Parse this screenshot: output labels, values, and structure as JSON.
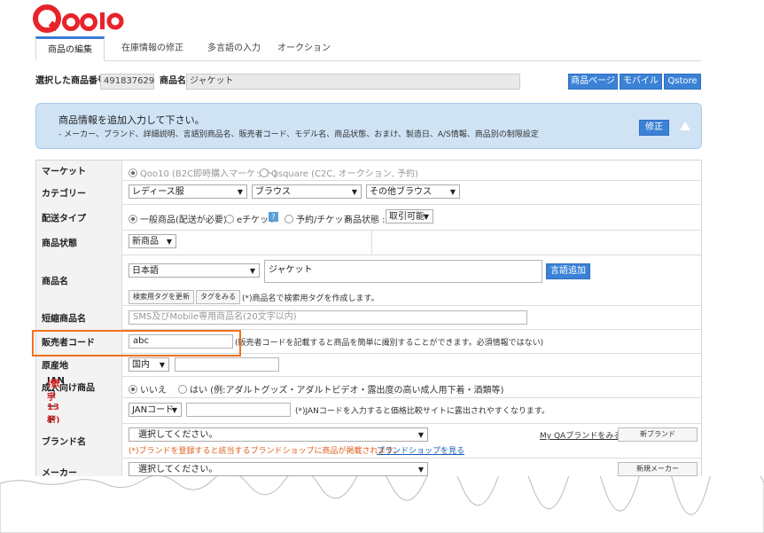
{
  "logo": {
    "text": "Qoo10",
    "color": "#e8232a"
  },
  "tabs": [
    {
      "label": "商品の編集",
      "active": true
    },
    {
      "label": "在庫情報の修正",
      "active": false
    },
    {
      "label": "多言語の入力",
      "active": false
    },
    {
      "label": "オークション",
      "active": false
    }
  ],
  "header": {
    "product_no_label": "選択した商品番号",
    "product_no": "491837629",
    "product_name_label": "商品名",
    "product_name": "ジャケット",
    "buttons": [
      "商品ページ",
      "モバイル",
      "Qstore"
    ]
  },
  "banner": {
    "title": "商品情報を追加入力して下さい。",
    "desc": "- メーカー、ブランド、詳細説明、言語別商品名、販売者コード、モデル名、商品状態、おまけ、製造日、A/S情報、商品別の制限設定",
    "edit_label": "修正"
  },
  "form": {
    "market": {
      "label": "マーケット",
      "opt1": "Qoo10 (B2C即時購入マーケット)",
      "opt2": "Qsquare (C2C, オークション, 予約)"
    },
    "category": {
      "label": "カテゴリー",
      "c1": "レディース服",
      "c2": "ブラウス",
      "c3": "その他ブラウス"
    },
    "delivery": {
      "label": "配送タイプ",
      "opt1": "一般商品(配送が必要)",
      "opt2": "eチケット",
      "help": "?",
      "opt3": "予約/チケット",
      "status_label": "商品状態 :",
      "status": "取引可能"
    },
    "condition": {
      "label": "商品状態",
      "value": "新商品"
    },
    "name": {
      "label": "商品名",
      "lang": "日本語",
      "value": "ジャケット",
      "add_lang": "言語追加",
      "tag_update": "検索用タグを更新",
      "tag_view": "タグをみる",
      "tag_note": "(*)商品名で検索用タグを作成します。"
    },
    "short_name": {
      "label": "短縮商品名",
      "placeholder": "SMS及びMobile専用商品名(20文字以内)"
    },
    "seller_code": {
      "label": "販売者コード",
      "value": "abc",
      "note": "(販売者コードを記載すると商品を簡単に識別することができます。必須情報ではない)"
    },
    "origin": {
      "label": "原産地",
      "value": "国内"
    },
    "adult": {
      "label": "成人向け商品",
      "opt1": "いいえ",
      "opt2": "はい (例:アダルトグッズ・アダルトビデオ・露出度の高い成人用下着・酒類等)"
    },
    "jan": {
      "label": "JANコード",
      "label_red": "(数字13桁)",
      "type": "JANコード",
      "note": "(*)JANコードを入力すると価格比較サイトに露出されやすくなります。"
    },
    "brand": {
      "label": "ブランド名",
      "placeholder": "選択してください。",
      "my_link": "My QAブランドをみる",
      "new_btn": "新ブランド",
      "note": "(*)ブランドを登録すると該当するブランドショップに商品が掲載されます。",
      "shop_link": "ブランドショップを見る"
    },
    "maker": {
      "label": "メーカー",
      "placeholder": "選択してください。",
      "new_btn": "新規メーカー"
    }
  }
}
